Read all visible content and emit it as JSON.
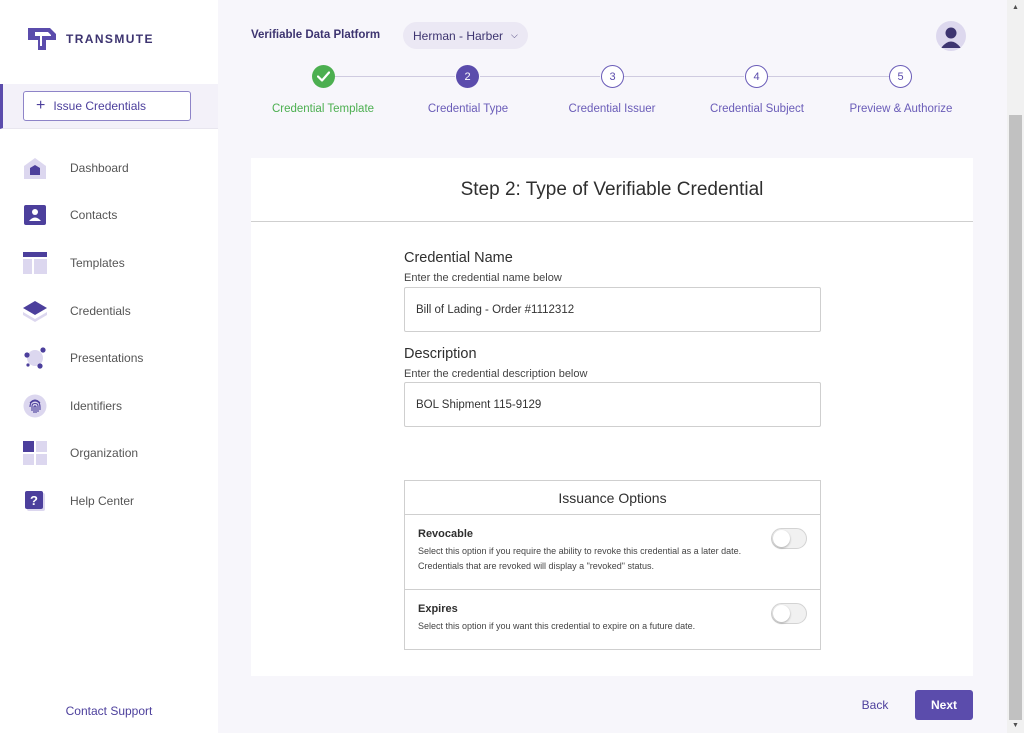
{
  "app": {
    "brand": "TRANSMUTE"
  },
  "sidebar": {
    "issue_button": "Issue Credentials",
    "items": [
      {
        "label": "Dashboard",
        "icon": "home-icon"
      },
      {
        "label": "Contacts",
        "icon": "contact-card-icon"
      },
      {
        "label": "Templates",
        "icon": "template-icon"
      },
      {
        "label": "Credentials",
        "icon": "credentials-stack-icon"
      },
      {
        "label": "Presentations",
        "icon": "presentations-icon"
      },
      {
        "label": "Identifiers",
        "icon": "fingerprint-icon"
      },
      {
        "label": "Organization",
        "icon": "organization-grid-icon"
      },
      {
        "label": "Help Center",
        "icon": "help-icon"
      }
    ],
    "contact_support": "Contact Support"
  },
  "header": {
    "platform_title": "Verifiable Data Platform",
    "org_selector": "Herman - Harber"
  },
  "stepper": {
    "steps": [
      {
        "number": "1",
        "label": "Credential Template",
        "state": "done"
      },
      {
        "number": "2",
        "label": "Credential Type",
        "state": "active"
      },
      {
        "number": "3",
        "label": "Credential Issuer",
        "state": "todo"
      },
      {
        "number": "4",
        "label": "Credential Subject",
        "state": "todo"
      },
      {
        "number": "5",
        "label": "Preview & Authorize",
        "state": "todo"
      }
    ]
  },
  "form": {
    "title": "Step 2: Type of Verifiable Credential",
    "name_label": "Credential Name",
    "name_help": "Enter the credential name below",
    "name_value": "Bill of Lading - Order #1112312",
    "description_label": "Description",
    "description_help": "Enter the credential description below",
    "description_value": "BOL Shipment 115-9129",
    "options_title": "Issuance Options",
    "options": [
      {
        "title": "Revocable",
        "description": "Select this option if you require the ability to revoke this credential as a later date. Credentials that are revoked will display a \"revoked\" status.",
        "enabled": false
      },
      {
        "title": "Expires",
        "description": "Select this option if you want this credential to expire on a future date.",
        "enabled": false
      }
    ]
  },
  "footer": {
    "back_label": "Back",
    "next_label": "Next"
  },
  "colors": {
    "primary": "#5b4cac",
    "success": "#4caf50",
    "background": "#f7f6fb"
  }
}
